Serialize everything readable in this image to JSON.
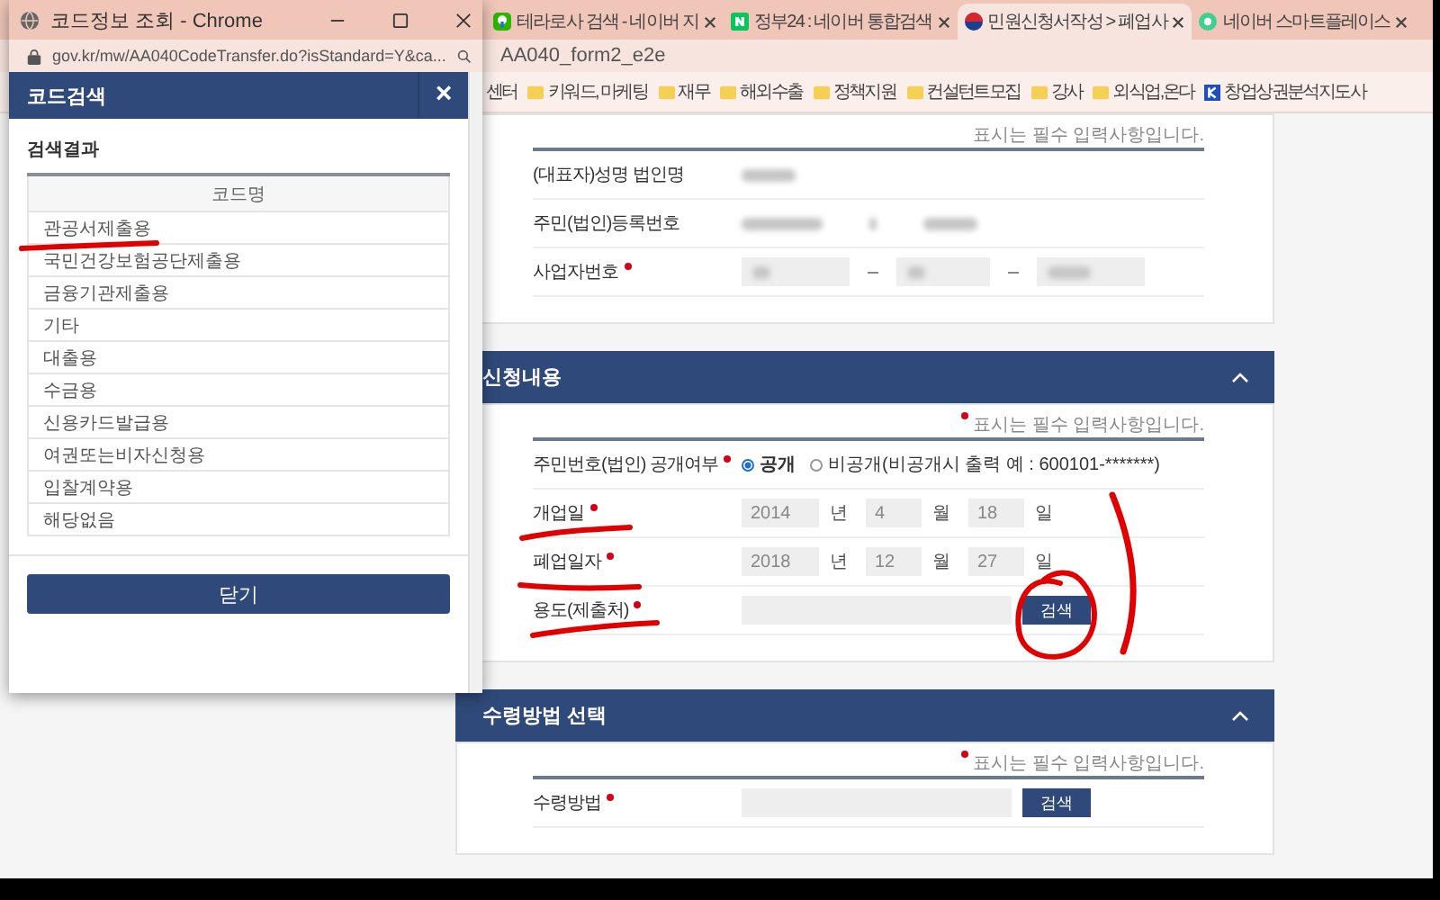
{
  "browser": {
    "tabs": [
      {
        "title": "테라로사 검색 - 네이버 지",
        "selected": false
      },
      {
        "title": "정부24 : 네이버 통합검색",
        "selected": false
      },
      {
        "title": "민원신청서작성 > 폐업사",
        "selected": true
      },
      {
        "title": "네이버 스마트플레이스",
        "selected": false
      }
    ],
    "address": "AA040_form2_e2e",
    "bookmarks": [
      {
        "label": "센터",
        "kind": "plain"
      },
      {
        "label": "키워드, 마케팅",
        "kind": "folder"
      },
      {
        "label": "재무",
        "kind": "folder"
      },
      {
        "label": "해외수출",
        "kind": "folder"
      },
      {
        "label": "정책지원",
        "kind": "folder"
      },
      {
        "label": "컨설턴트모집",
        "kind": "folder"
      },
      {
        "label": "강사",
        "kind": "folder"
      },
      {
        "label": "외식업,온다",
        "kind": "folder"
      },
      {
        "label": "창업상권분석지도사",
        "kind": "app"
      }
    ]
  },
  "page": {
    "sections": [
      {
        "note": "표시는 필수 입력사항입니다.",
        "note_star": false,
        "rows": [
          {
            "kind": "blurred",
            "label": "(대표자)성명 법인명",
            "required": false
          },
          {
            "kind": "blurred_pair",
            "label": "주민(법인)등록번호",
            "required": false
          },
          {
            "kind": "blurred_fields",
            "label": "사업자번호",
            "required": true
          }
        ]
      },
      {
        "title": "신청내용",
        "note": "표시는 필수 입력사항입니다.",
        "note_star": true,
        "rows": [
          {
            "kind": "radio",
            "label": "주민번호(법인) 공개여부",
            "required": true,
            "options": [
              {
                "label": "공개",
                "selected": true
              },
              {
                "label": "비공개(비공개시 출력 예 : 600101-*******)",
                "selected": false
              }
            ]
          },
          {
            "kind": "date",
            "label": "개업일",
            "required": true,
            "parts": [
              {
                "value": "2014",
                "unit": "년"
              },
              {
                "value": "4",
                "unit": "월"
              },
              {
                "value": "18",
                "unit": "일"
              }
            ]
          },
          {
            "kind": "date",
            "label": "폐업일자",
            "required": true,
            "parts": [
              {
                "value": "2018",
                "unit": "년"
              },
              {
                "value": "12",
                "unit": "월"
              },
              {
                "value": "27",
                "unit": "일"
              }
            ]
          },
          {
            "kind": "search",
            "label": "용도(제출처)",
            "required": true,
            "button": "검색"
          }
        ]
      },
      {
        "title": "수령방법 선택",
        "note": "표시는 필수 입력사항입니다.",
        "note_star": true,
        "rows": [
          {
            "kind": "search",
            "label": "수령방법",
            "required": true,
            "button": "검색"
          }
        ]
      }
    ]
  },
  "popup": {
    "title": "코드정보 조회 - Chrome",
    "url": "gov.kr/mw/AA040CodeTransfer.do?isStandard=Y&ca...",
    "header": "코드검색",
    "close": "×",
    "results_title": "검색결과",
    "table": {
      "columns": [
        "코드명"
      ],
      "rows": [
        "관공서제출용",
        "국민건강보험공단제출용",
        "금융기관제출용",
        "기타",
        "대출용",
        "수금용",
        "신용카드발급용",
        "여권또는비자신청용",
        "입찰계약용",
        "해당없음"
      ]
    },
    "close_button": "닫기"
  }
}
